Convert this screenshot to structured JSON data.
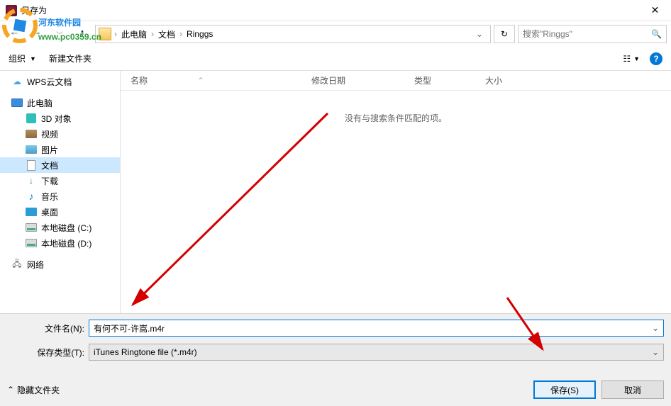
{
  "window": {
    "title": "另存为"
  },
  "breadcrumb": {
    "segments": [
      "此电脑",
      "文档",
      "Ringgs"
    ]
  },
  "search": {
    "placeholder": "搜索\"Ringgs\""
  },
  "row2": {
    "organize": "组织",
    "newfolder": "新建文件夹"
  },
  "sidebar": {
    "cloud": "WPS云文档",
    "pc": "此电脑",
    "d3": "3D 对象",
    "video": "视频",
    "pic": "图片",
    "doc": "文档",
    "dl": "下载",
    "music": "音乐",
    "desktop": "桌面",
    "diskC": "本地磁盘 (C:)",
    "diskD": "本地磁盘 (D:)",
    "network": "网络"
  },
  "columns": {
    "name": "名称",
    "date": "修改日期",
    "type": "类型",
    "size": "大小"
  },
  "empty": "没有与搜索条件匹配的项。",
  "filename_label": "文件名(N):",
  "filename_value": "有何不可-许嵩.m4r",
  "filetype_label": "保存类型(T):",
  "filetype_value": "iTunes Ringtone file (*.m4r)",
  "hide_folders": "隐藏文件夹",
  "save_btn": "保存(S)",
  "cancel_btn": "取消",
  "watermark": {
    "line1": "河东软件园",
    "line2": "www.pc0359.cn"
  }
}
